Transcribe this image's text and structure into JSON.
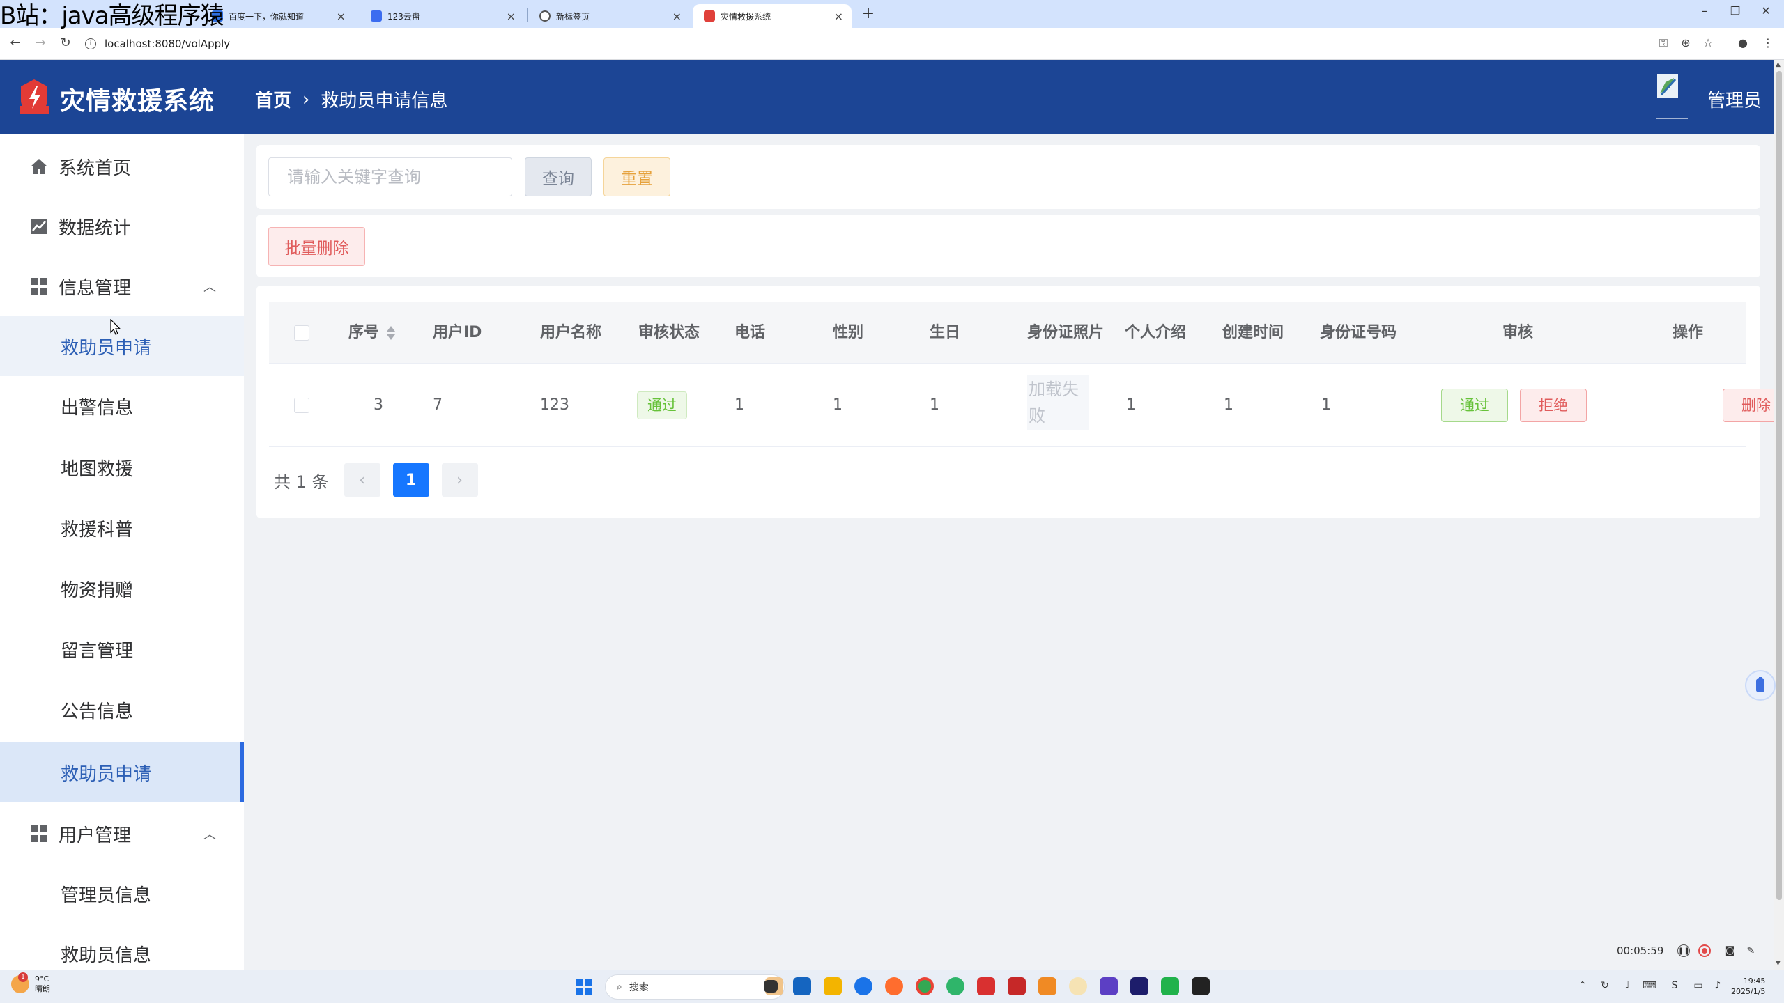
{
  "watermark": "B站：java高级程序猿",
  "browser": {
    "tabs": [
      {
        "label": "百度一下，你就知道",
        "icon_color": "#2f6fe0"
      },
      {
        "label": "123云盘",
        "icon_color": "#3b6cf0"
      },
      {
        "label": "新标签页",
        "icon_color": "#555555"
      },
      {
        "label": "灾情救援系统",
        "icon_color": "#e0403a"
      }
    ],
    "url": "localhost:8080/volApply"
  },
  "header": {
    "title": "灾情救援系统",
    "breadcrumb_home": "首页",
    "breadcrumb_current": "救助员申请信息",
    "user_name": "管理员",
    "bg_color": "#1c4595"
  },
  "sidebar": {
    "home": "系统首页",
    "stats": "数据统计",
    "info_group": "信息管理",
    "info_items": [
      "救助员申请",
      "出警信息",
      "地图救援",
      "救援科普",
      "物资捐赠",
      "留言管理",
      "公告信息",
      "救助员申请"
    ],
    "user_group": "用户管理",
    "user_items": [
      "管理员信息",
      "救助员信息"
    ]
  },
  "search": {
    "placeholder": "请输入关键字查询",
    "value": "",
    "query_label": "查询",
    "reset_label": "重置",
    "batch_delete_label": "批量删除"
  },
  "table": {
    "columns": [
      "序号",
      "用户ID",
      "用户名称",
      "审核状态",
      "电话",
      "性别",
      "生日",
      "身份证照片",
      "个人介绍",
      "创建时间",
      "身份证号码",
      "审核",
      "操作"
    ],
    "rows": [
      {
        "index": "3",
        "user_id": "7",
        "user_name": "123",
        "status": "通过",
        "phone": "1",
        "gender": "1",
        "birthday": "1",
        "id_photo": "加载失败",
        "intro": "1",
        "created": "1",
        "id_number": "1",
        "approve_label": "通过",
        "reject_label": "拒绝",
        "delete_label": "删除"
      }
    ]
  },
  "pagination": {
    "total_text": "共 1 条",
    "prev": "‹",
    "current_page": "1",
    "next": "›"
  },
  "recorder": {
    "time": "00:05:59"
  },
  "taskbar": {
    "temperature": "9°C",
    "weather": "晴朗",
    "weather_badge": "1",
    "search_label": "搜索",
    "time": "19:45",
    "date": "2025/1/5"
  }
}
